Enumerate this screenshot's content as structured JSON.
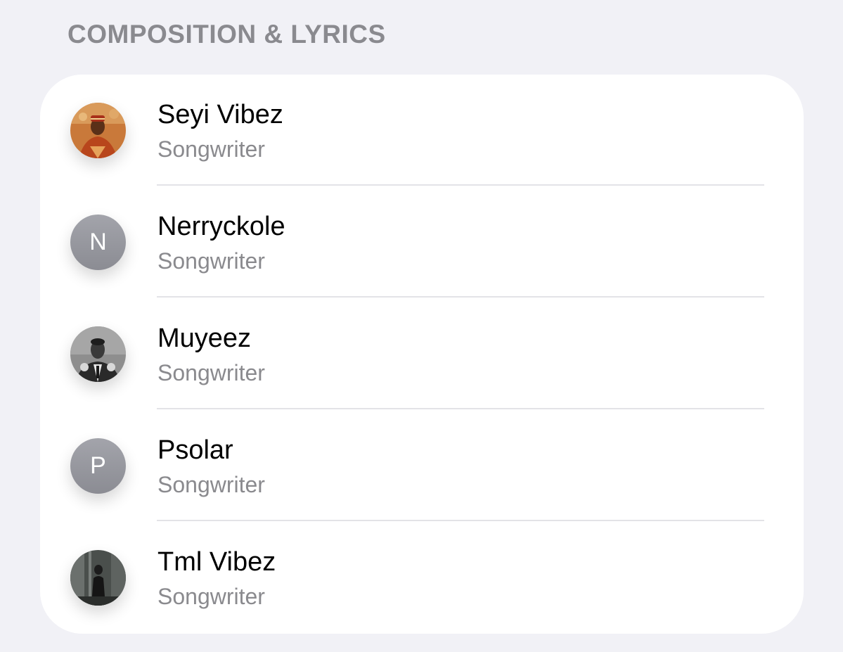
{
  "section": {
    "title": "COMPOSITION & LYRICS"
  },
  "credits": [
    {
      "name": "Seyi Vibez",
      "role": "Songwriter",
      "avatar": "photo"
    },
    {
      "name": "Nerryckole",
      "role": "Songwriter",
      "avatar": "initial",
      "initial": "N"
    },
    {
      "name": "Muyeez",
      "role": "Songwriter",
      "avatar": "photo"
    },
    {
      "name": "Psolar",
      "role": "Songwriter",
      "avatar": "initial",
      "initial": "P"
    },
    {
      "name": "Tml Vibez",
      "role": "Songwriter",
      "avatar": "photo"
    }
  ],
  "colors": {
    "background": "#f1f1f6",
    "card": "#ffffff",
    "header_text": "#8a8a8f",
    "secondary_text": "#8a8a8e",
    "initial_avatar": "#9a9ba2"
  }
}
